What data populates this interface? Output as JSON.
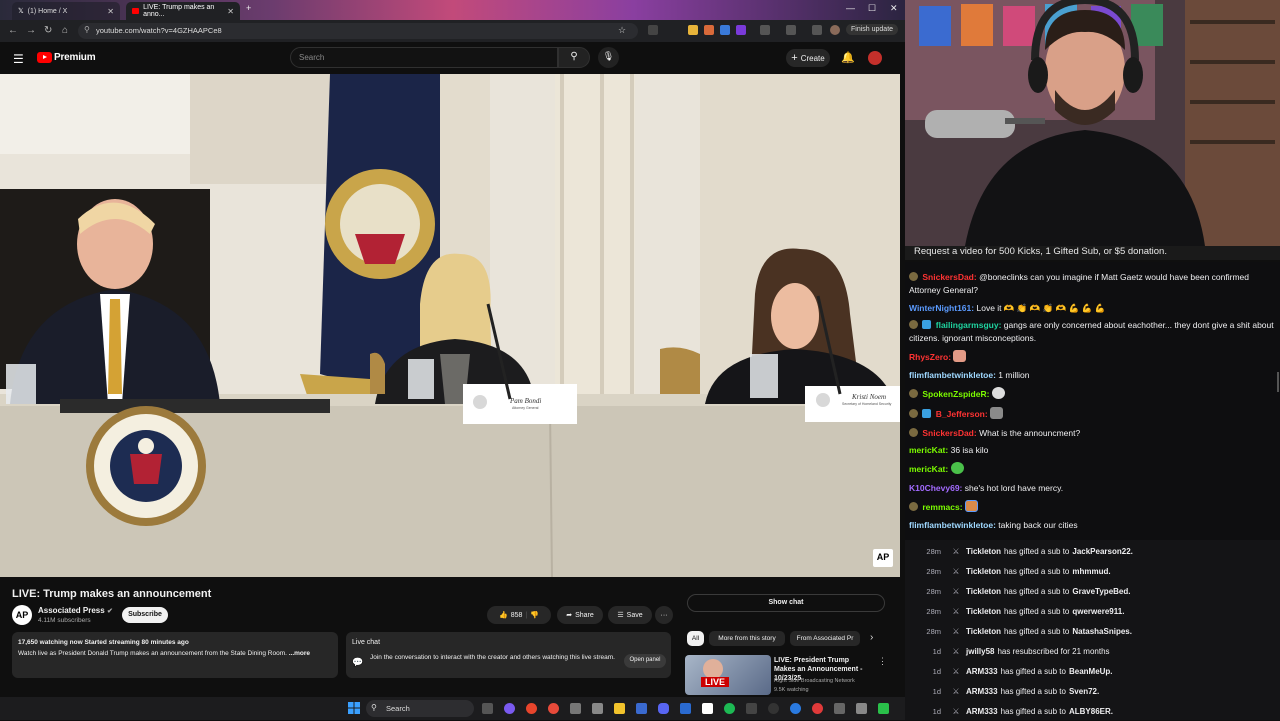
{
  "browser": {
    "tabs": [
      {
        "label": "(1) Home / X"
      },
      {
        "label": "LIVE: Trump makes an anno..."
      }
    ],
    "url": "youtube.com/watch?v=4GZHAAPCe8",
    "finish_update": "Finish update"
  },
  "youtube": {
    "logo_text": "Premium",
    "search_placeholder": "Search",
    "create_label": "Create",
    "video": {
      "title": "LIVE: Trump makes an announcement",
      "nameplate_1": "Pam Bondi",
      "nameplate_1_sub": "Attorney General",
      "nameplate_2": "Kristi Noem",
      "nameplate_2_sub": "Secretary of Homeland Security",
      "ap_bug": "AP"
    },
    "channel": {
      "logo": "AP",
      "name": "Associated Press",
      "subscribers": "4.11M subscribers",
      "subscribe_label": "Subscribe"
    },
    "actions": {
      "likes": "858",
      "share": "Share",
      "save": "Save",
      "more": "···"
    },
    "description": {
      "stats": "17,650 watching now  Started streaming 80 minutes ago",
      "text": "Watch live as President Donald Trump makes an announcement from the State Dining Room.",
      "more": "...more"
    },
    "live_chat_box": {
      "title": "Live chat",
      "text": "Join the conversation to interact with the creator and others watching this live stream.",
      "open_panel": "Open panel"
    },
    "show_chat": "Show chat",
    "chips": [
      "All",
      "More from this story",
      "From Associated Pr"
    ],
    "recommendation": {
      "thumb_badge": "LIVE",
      "title": "LIVE: President Trump Makes an Announcement - 10/23/25",
      "channel": "Right Side Broadcasting Network",
      "views": "9.5K watching"
    }
  },
  "stream": {
    "request_banner": "Request a video for 500 Kicks, 1 Gifted Sub, or $5 donation.",
    "chat": [
      {
        "user": "SnickersDad:",
        "color": "#ff3333",
        "text": "@boneclinks can you imagine if Matt Gaetz would have been confirmed Attorney General?",
        "bold_mention": true
      },
      {
        "user": "WinterNight161:",
        "color": "#5b9bff",
        "text": "Love it 🫶 👏 🫶 👏 🫶 💪 💪 💪"
      },
      {
        "user": "flailingarmsguy:",
        "color": "#1fd4a0",
        "text": "gangs are only concerned about eachother... they dont give a shit about citizens. ignorant misconceptions."
      },
      {
        "user": "RhysZero:",
        "color": "#ff3333",
        "text": ""
      },
      {
        "user": "flimflambetwinkletoe:",
        "color": "#9fd8ff",
        "text": "1 million"
      },
      {
        "user": "SpokenZspideR:",
        "color": "#7cfc00",
        "text": ""
      },
      {
        "user": "B_Jefferson:",
        "color": "#ff3333",
        "text": ""
      },
      {
        "user": "SnickersDad:",
        "color": "#ff3333",
        "text": "What is the announcment?"
      },
      {
        "user": "mericKat:",
        "color": "#7cfc00",
        "text": "36 isa kilo"
      },
      {
        "user": "mericKat:",
        "color": "#7cfc00",
        "text": ""
      },
      {
        "user": "K10Chevy69:",
        "color": "#a36bff",
        "text": "she's hot lord have mercy."
      },
      {
        "user": "remmacs:",
        "color": "#7cfc00",
        "text": ""
      },
      {
        "user": "flimflambetwinkletoe:",
        "color": "#9fd8ff",
        "text": "taking back our cities"
      }
    ],
    "events": [
      {
        "time": "28m",
        "user": "Tickleton",
        "action": "has gifted a sub to",
        "recipient": "JackPearson22."
      },
      {
        "time": "28m",
        "user": "Tickleton",
        "action": "has gifted a sub to",
        "recipient": "mhmmud."
      },
      {
        "time": "28m",
        "user": "Tickleton",
        "action": "has gifted a sub to",
        "recipient": "GraveTypeBed."
      },
      {
        "time": "28m",
        "user": "Tickleton",
        "action": "has gifted a sub to",
        "recipient": "qwerwere911."
      },
      {
        "time": "28m",
        "user": "Tickleton",
        "action": "has gifted a sub to",
        "recipient": "NatashaSnipes."
      },
      {
        "time": "1d",
        "user": "jwilly58",
        "action": "has resubscribed for 21 months",
        "recipient": ""
      },
      {
        "time": "1d",
        "user": "ARM333",
        "action": "has gifted a sub to",
        "recipient": "BeanMeUp."
      },
      {
        "time": "1d",
        "user": "ARM333",
        "action": "has gifted a sub to",
        "recipient": "Sven72."
      },
      {
        "time": "1d",
        "user": "ARM333",
        "action": "has gifted a sub to",
        "recipient": "ALBY86ER."
      }
    ]
  },
  "taskbar": {
    "search_label": "Search"
  }
}
